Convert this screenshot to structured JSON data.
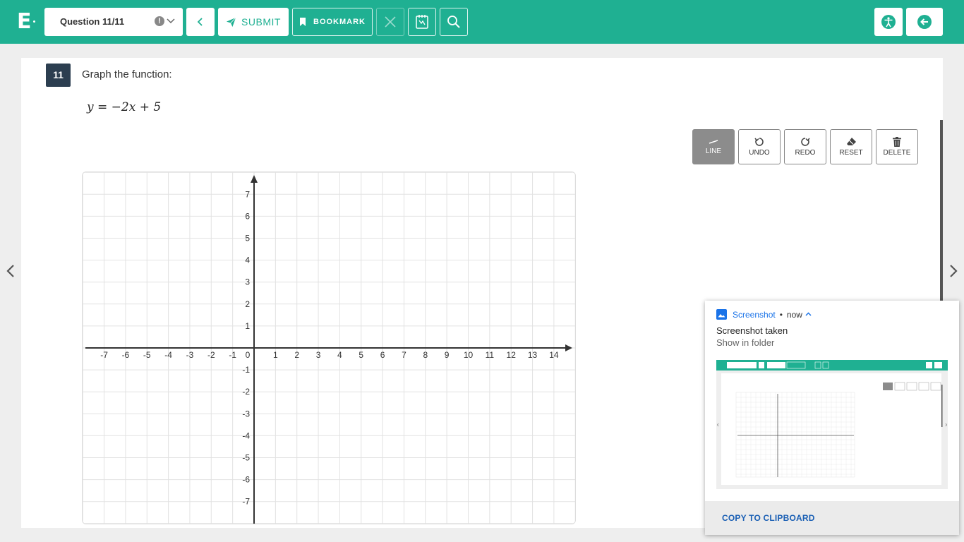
{
  "topbar": {
    "logo": "E",
    "question_select": "Question 11/11",
    "submit_label": "SUBMIT",
    "bookmark_label": "BOOKMARK",
    "accent_color": "#1fb092"
  },
  "question": {
    "number": "11",
    "prompt": "Graph the function:",
    "equation": "y = −2x + 5"
  },
  "tools": {
    "line": "LINE",
    "undo": "UNDO",
    "redo": "REDO",
    "reset": "RESET",
    "delete": "DELETE"
  },
  "graph": {
    "x_labels": [
      "-7",
      "-6",
      "-5",
      "-4",
      "-3",
      "-2",
      "-1",
      "0",
      "1",
      "2",
      "3",
      "4",
      "5",
      "6",
      "7",
      "8",
      "9",
      "10",
      "11",
      "12",
      "13",
      "14"
    ],
    "y_labels_pos": [
      "7",
      "6",
      "5",
      "4",
      "3",
      "2",
      "1"
    ],
    "y_labels_neg": [
      "-1",
      "-2",
      "-3",
      "-4",
      "-5",
      "-6",
      "-7"
    ]
  },
  "notification": {
    "app": "Screenshot",
    "time": "now",
    "title": "Screenshot taken",
    "subtitle": "Show in folder",
    "action": "COPY TO CLIPBOARD"
  }
}
